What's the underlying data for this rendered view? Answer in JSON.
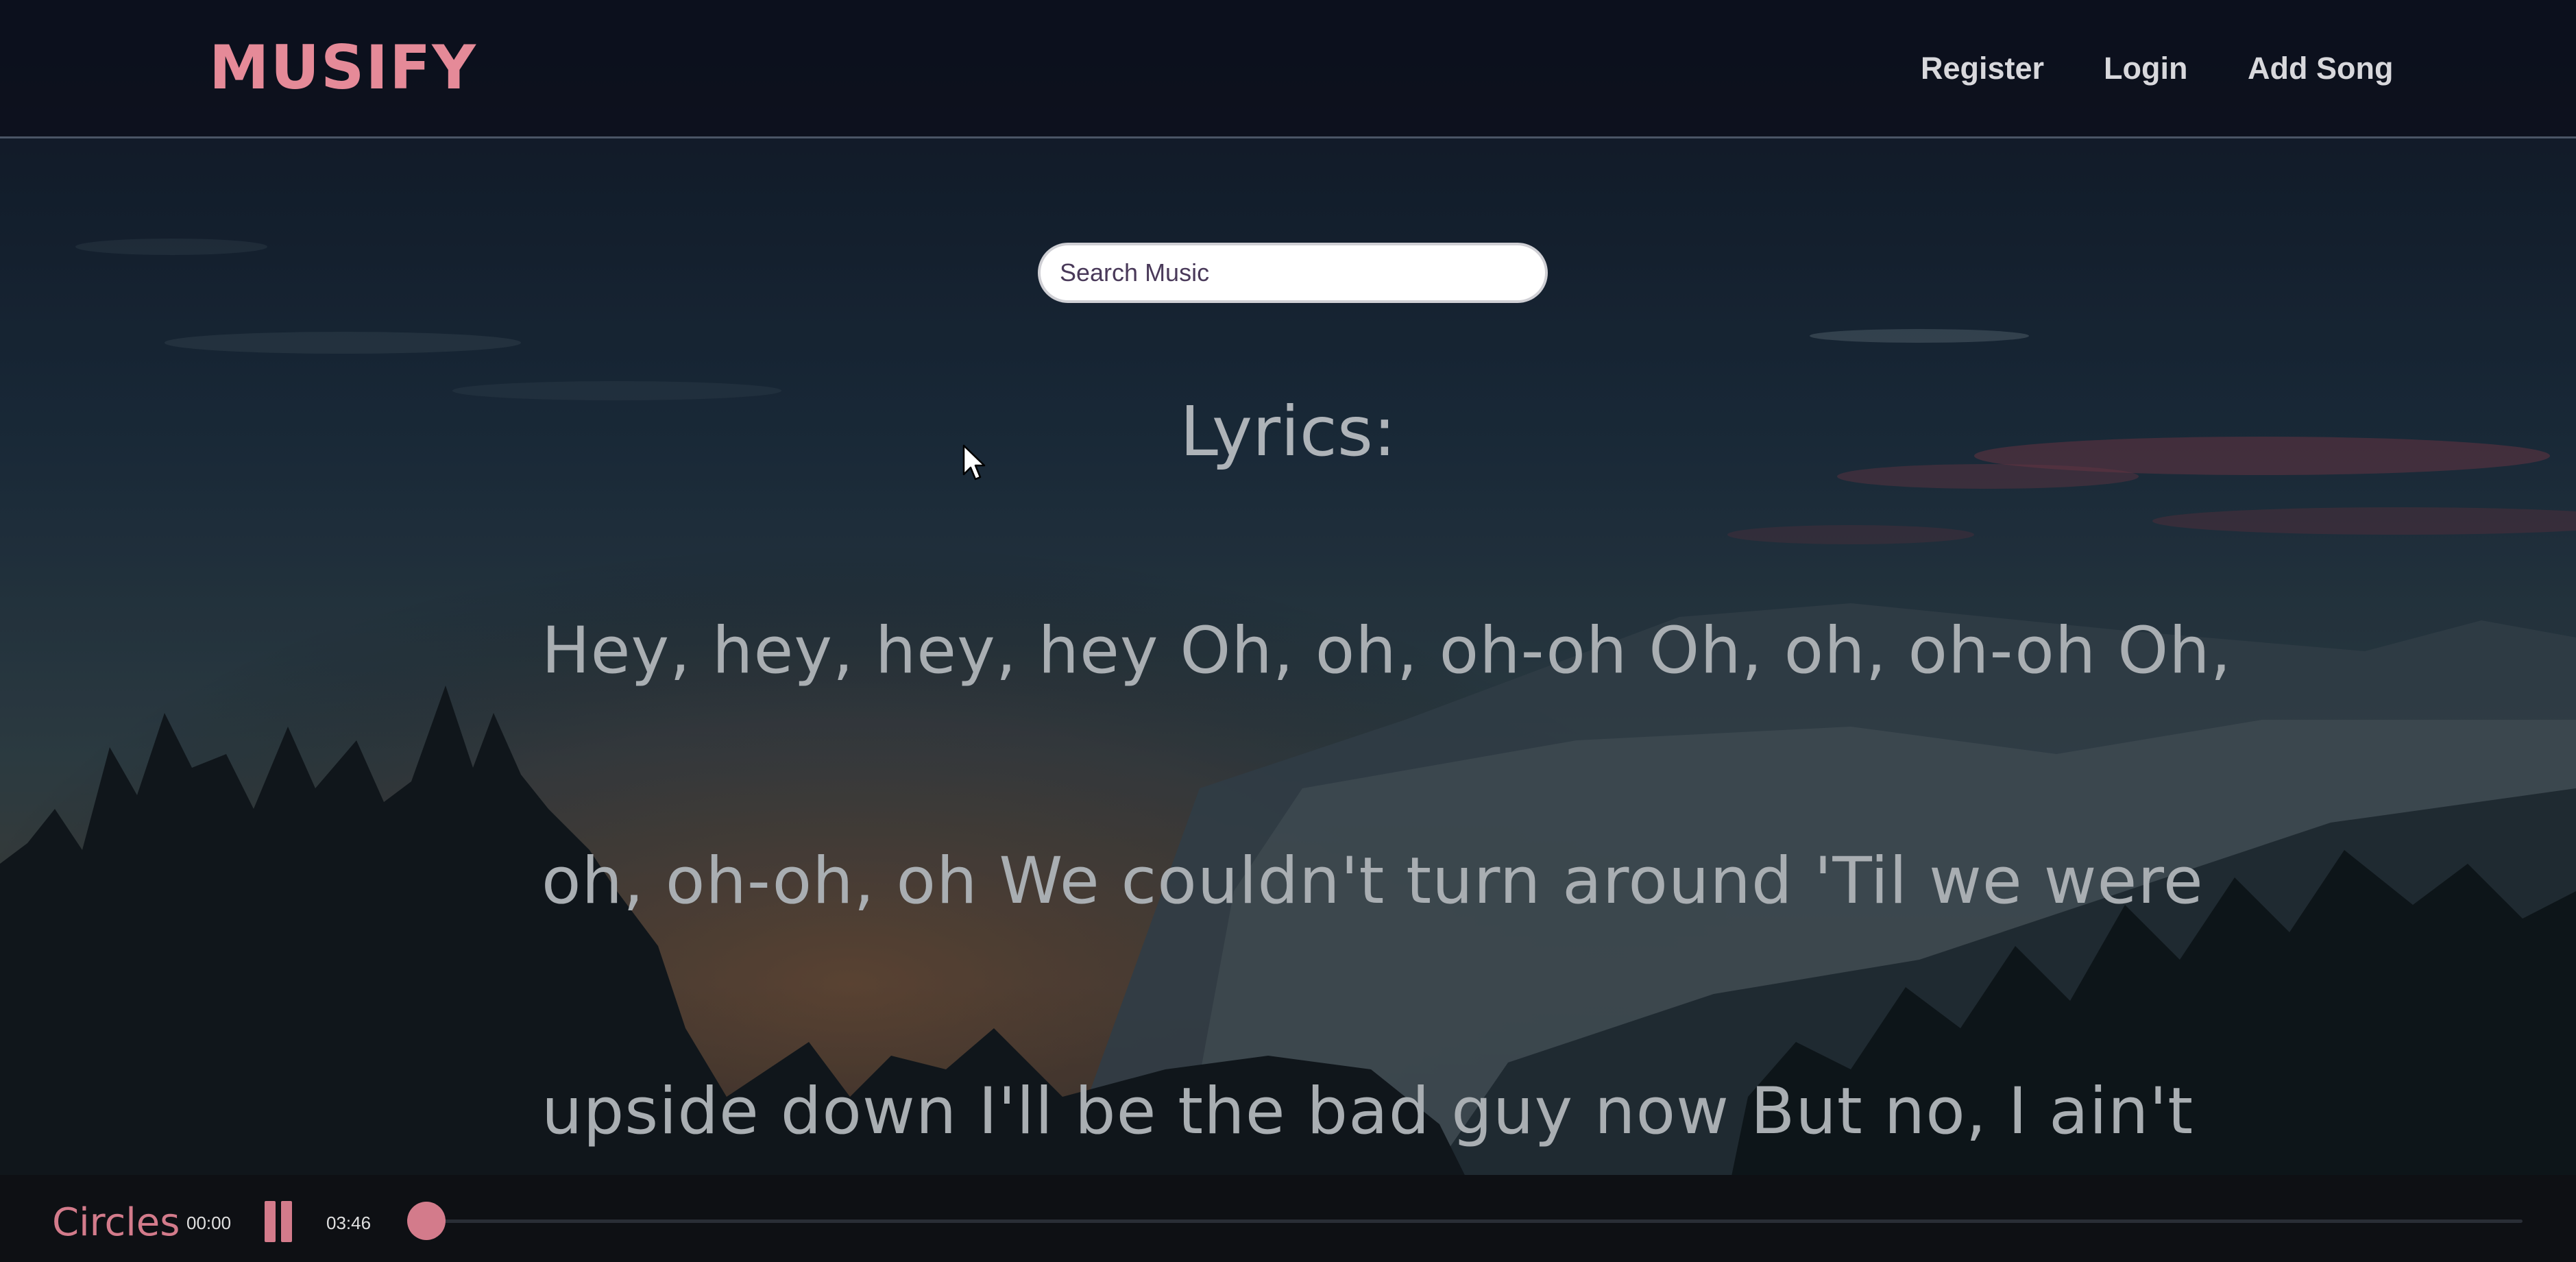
{
  "app": {
    "logo": "MUSIFY"
  },
  "nav": {
    "register": "Register",
    "login": "Login",
    "add_song": "Add Song"
  },
  "search": {
    "placeholder": "Search Music",
    "value": ""
  },
  "lyrics": {
    "title": "Lyrics:",
    "lines": [
      "Hey, hey, hey, hey Oh, oh, oh-oh Oh, oh, oh-oh Oh,",
      "oh, oh-oh, oh We couldn't turn around 'Til we were",
      "upside down I'll be the bad guy now But no, I ain't"
    ]
  },
  "player": {
    "song_title": "Circles",
    "current_time": "00:00",
    "total_time": "03:46",
    "progress": 0.0,
    "state": "playing",
    "pause_icon": "pause-icon"
  },
  "colors": {
    "accent": "#d37b8b",
    "logo": "#e58a98",
    "nav_text": "#d8d8dc",
    "lyrics_text": "#a9aeb2"
  }
}
